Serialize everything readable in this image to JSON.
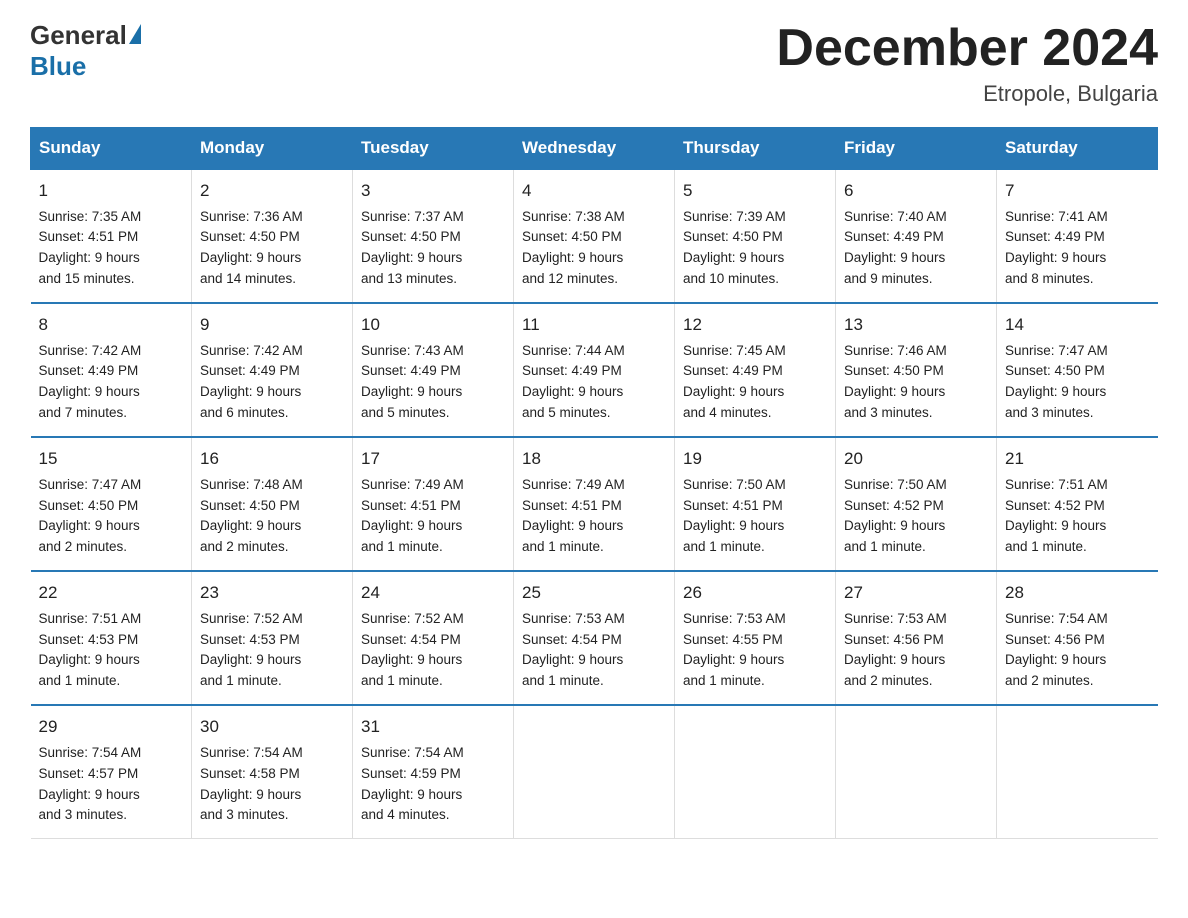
{
  "logo": {
    "general": "General",
    "blue": "Blue"
  },
  "title": {
    "month_year": "December 2024",
    "location": "Etropole, Bulgaria"
  },
  "weekdays": [
    "Sunday",
    "Monday",
    "Tuesday",
    "Wednesday",
    "Thursday",
    "Friday",
    "Saturday"
  ],
  "weeks": [
    [
      {
        "day": "1",
        "sunrise": "7:35 AM",
        "sunset": "4:51 PM",
        "daylight": "9 hours and 15 minutes."
      },
      {
        "day": "2",
        "sunrise": "7:36 AM",
        "sunset": "4:50 PM",
        "daylight": "9 hours and 14 minutes."
      },
      {
        "day": "3",
        "sunrise": "7:37 AM",
        "sunset": "4:50 PM",
        "daylight": "9 hours and 13 minutes."
      },
      {
        "day": "4",
        "sunrise": "7:38 AM",
        "sunset": "4:50 PM",
        "daylight": "9 hours and 12 minutes."
      },
      {
        "day": "5",
        "sunrise": "7:39 AM",
        "sunset": "4:50 PM",
        "daylight": "9 hours and 10 minutes."
      },
      {
        "day": "6",
        "sunrise": "7:40 AM",
        "sunset": "4:49 PM",
        "daylight": "9 hours and 9 minutes."
      },
      {
        "day": "7",
        "sunrise": "7:41 AM",
        "sunset": "4:49 PM",
        "daylight": "9 hours and 8 minutes."
      }
    ],
    [
      {
        "day": "8",
        "sunrise": "7:42 AM",
        "sunset": "4:49 PM",
        "daylight": "9 hours and 7 minutes."
      },
      {
        "day": "9",
        "sunrise": "7:42 AM",
        "sunset": "4:49 PM",
        "daylight": "9 hours and 6 minutes."
      },
      {
        "day": "10",
        "sunrise": "7:43 AM",
        "sunset": "4:49 PM",
        "daylight": "9 hours and 5 minutes."
      },
      {
        "day": "11",
        "sunrise": "7:44 AM",
        "sunset": "4:49 PM",
        "daylight": "9 hours and 5 minutes."
      },
      {
        "day": "12",
        "sunrise": "7:45 AM",
        "sunset": "4:49 PM",
        "daylight": "9 hours and 4 minutes."
      },
      {
        "day": "13",
        "sunrise": "7:46 AM",
        "sunset": "4:50 PM",
        "daylight": "9 hours and 3 minutes."
      },
      {
        "day": "14",
        "sunrise": "7:47 AM",
        "sunset": "4:50 PM",
        "daylight": "9 hours and 3 minutes."
      }
    ],
    [
      {
        "day": "15",
        "sunrise": "7:47 AM",
        "sunset": "4:50 PM",
        "daylight": "9 hours and 2 minutes."
      },
      {
        "day": "16",
        "sunrise": "7:48 AM",
        "sunset": "4:50 PM",
        "daylight": "9 hours and 2 minutes."
      },
      {
        "day": "17",
        "sunrise": "7:49 AM",
        "sunset": "4:51 PM",
        "daylight": "9 hours and 1 minute."
      },
      {
        "day": "18",
        "sunrise": "7:49 AM",
        "sunset": "4:51 PM",
        "daylight": "9 hours and 1 minute."
      },
      {
        "day": "19",
        "sunrise": "7:50 AM",
        "sunset": "4:51 PM",
        "daylight": "9 hours and 1 minute."
      },
      {
        "day": "20",
        "sunrise": "7:50 AM",
        "sunset": "4:52 PM",
        "daylight": "9 hours and 1 minute."
      },
      {
        "day": "21",
        "sunrise": "7:51 AM",
        "sunset": "4:52 PM",
        "daylight": "9 hours and 1 minute."
      }
    ],
    [
      {
        "day": "22",
        "sunrise": "7:51 AM",
        "sunset": "4:53 PM",
        "daylight": "9 hours and 1 minute."
      },
      {
        "day": "23",
        "sunrise": "7:52 AM",
        "sunset": "4:53 PM",
        "daylight": "9 hours and 1 minute."
      },
      {
        "day": "24",
        "sunrise": "7:52 AM",
        "sunset": "4:54 PM",
        "daylight": "9 hours and 1 minute."
      },
      {
        "day": "25",
        "sunrise": "7:53 AM",
        "sunset": "4:54 PM",
        "daylight": "9 hours and 1 minute."
      },
      {
        "day": "26",
        "sunrise": "7:53 AM",
        "sunset": "4:55 PM",
        "daylight": "9 hours and 1 minute."
      },
      {
        "day": "27",
        "sunrise": "7:53 AM",
        "sunset": "4:56 PM",
        "daylight": "9 hours and 2 minutes."
      },
      {
        "day": "28",
        "sunrise": "7:54 AM",
        "sunset": "4:56 PM",
        "daylight": "9 hours and 2 minutes."
      }
    ],
    [
      {
        "day": "29",
        "sunrise": "7:54 AM",
        "sunset": "4:57 PM",
        "daylight": "9 hours and 3 minutes."
      },
      {
        "day": "30",
        "sunrise": "7:54 AM",
        "sunset": "4:58 PM",
        "daylight": "9 hours and 3 minutes."
      },
      {
        "day": "31",
        "sunrise": "7:54 AM",
        "sunset": "4:59 PM",
        "daylight": "9 hours and 4 minutes."
      },
      null,
      null,
      null,
      null
    ]
  ],
  "labels": {
    "sunrise": "Sunrise:",
    "sunset": "Sunset:",
    "daylight": "Daylight:"
  }
}
